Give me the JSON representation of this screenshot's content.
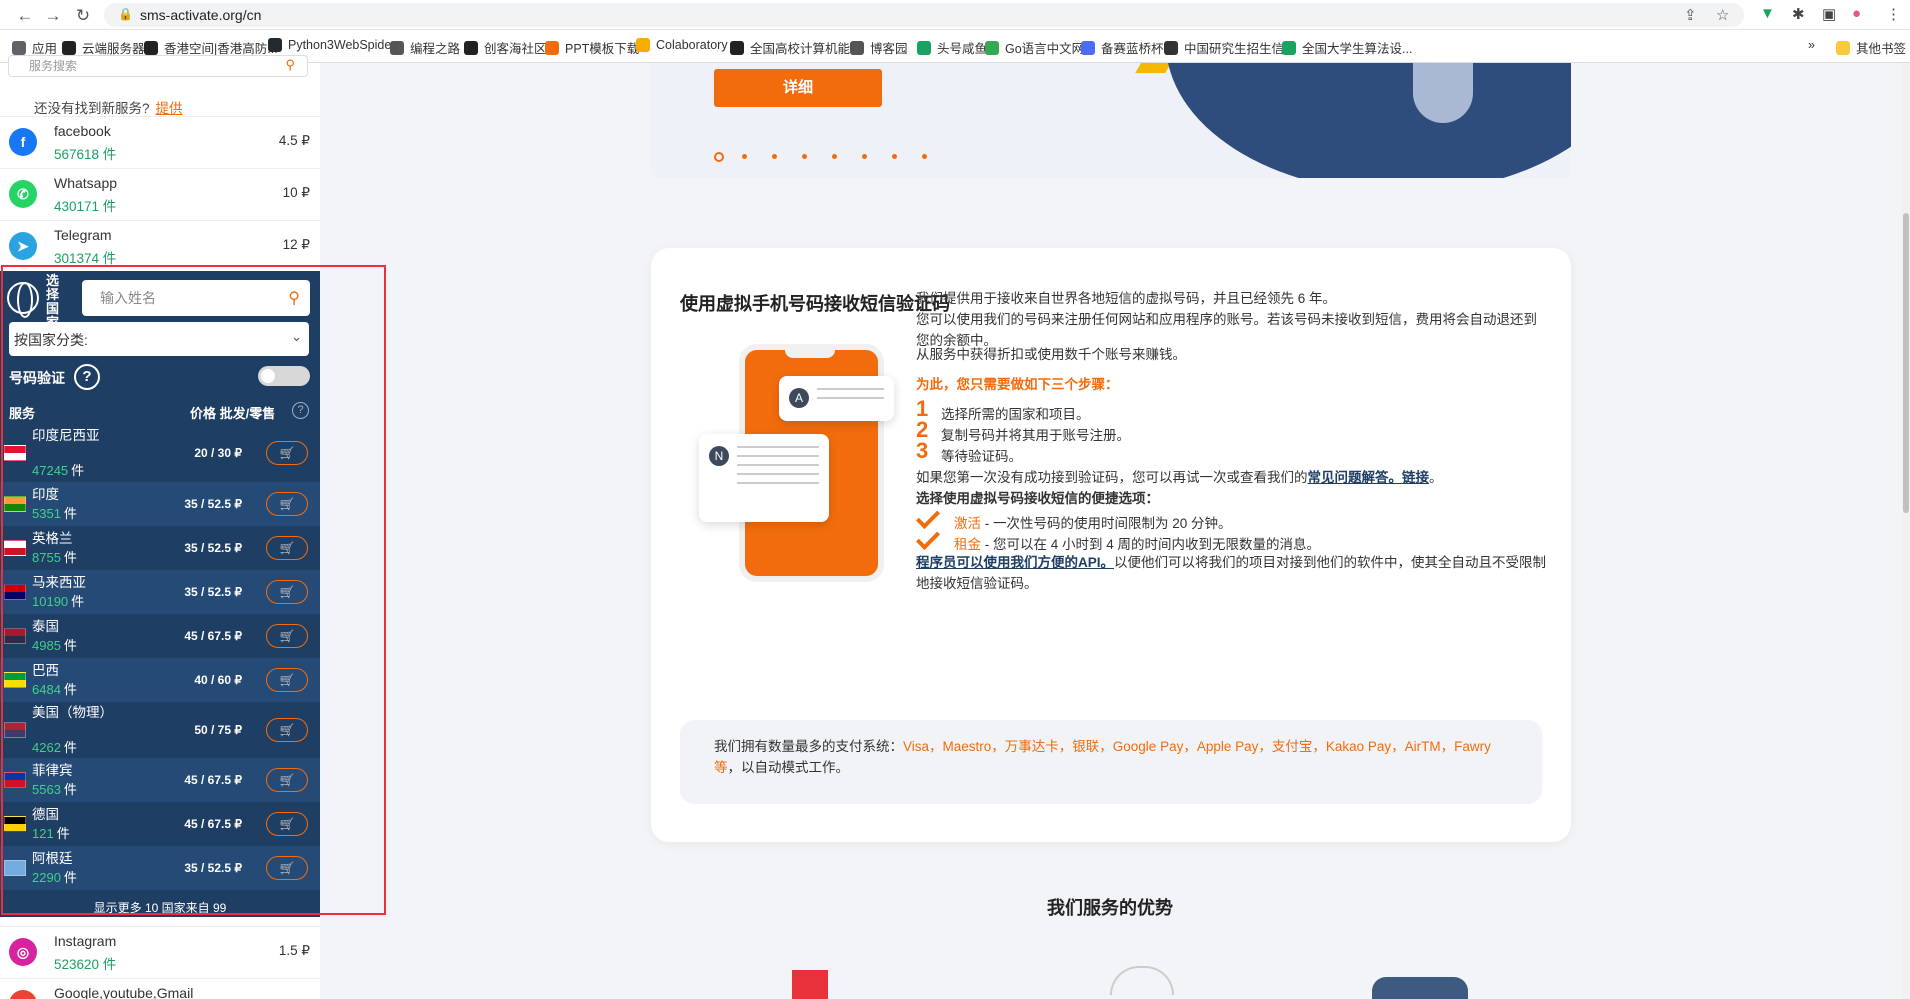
{
  "browser": {
    "url": "sms-activate.org/cn",
    "bookmarks": [
      {
        "label": "应用",
        "color": "#5f6368"
      },
      {
        "label": "云端服务器",
        "color": "#222222"
      },
      {
        "label": "香港空间|香港高防...",
        "color": "#222222"
      },
      {
        "label": "Python3WebSpider",
        "color": "#24292e"
      },
      {
        "label": "编程之路",
        "color": "#555555"
      },
      {
        "label": "创客海社区",
        "color": "#222222"
      },
      {
        "label": "PPT模板下载",
        "color": "#f26c0d"
      },
      {
        "label": "Colaboratory",
        "color": "#f9ab00"
      },
      {
        "label": "全国高校计算机能...",
        "color": "#222222"
      },
      {
        "label": "博客园",
        "color": "#555555"
      },
      {
        "label": "头号咸鱼",
        "color": "#1aa260"
      },
      {
        "label": "Go语言中文网",
        "color": "#34a853"
      },
      {
        "label": "备赛蓝桥杯",
        "color": "#4a6cf7"
      },
      {
        "label": "中国研究生招生信...",
        "color": "#333333"
      },
      {
        "label": "全国大学生算法设...",
        "color": "#1aa260"
      }
    ],
    "other_bookmarks": "其他书签"
  },
  "left": {
    "search_placeholder": "服务搜索",
    "not_found": "还没有找到新服务?",
    "suggest_link": "提供",
    "services_top": [
      {
        "name": "facebook",
        "count": "567618 件",
        "price": "4.5 ₽",
        "color": "#1877f2",
        "letter": "f"
      },
      {
        "name": "Whatsapp",
        "count": "430171 件",
        "price": "10 ₽",
        "color": "#25d366",
        "letter": "✆"
      },
      {
        "name": "Telegram",
        "count": "301374 件",
        "price": "12 ₽",
        "color": "#2aa3df",
        "letter": "➤"
      }
    ],
    "services_bottom": [
      {
        "name": "Instagram",
        "count": "523620 件",
        "price": "1.5 ₽",
        "color": "#d6249f",
        "letter": "◎"
      },
      {
        "name": "Google,youtube,Gmail",
        "count": "",
        "price": "",
        "color": "#ea4335",
        "letter": "G"
      }
    ]
  },
  "panel": {
    "vertical_label": "选择国家",
    "name_placeholder": "输入姓名",
    "category_select": "按国家分类:",
    "verify_label": "号码验证",
    "col_service": "服务",
    "col_price": "价格 批发/零售",
    "countries": [
      {
        "name": "印度尼西亚",
        "count": "47245",
        "unit": "件",
        "price": "20 / 30 ₽",
        "flag_top": "#e8112d",
        "flag_bottom": "#ffffff"
      },
      {
        "name": "印度",
        "count": "5351",
        "unit": "件",
        "price": "35 / 52.5 ₽",
        "flag_top": "#ff9933",
        "flag_bottom": "#138808"
      },
      {
        "name": "英格兰",
        "count": "8755",
        "unit": "件",
        "price": "35 / 52.5 ₽",
        "flag_top": "#ffffff",
        "flag_bottom": "#ce1124"
      },
      {
        "name": "马来西亚",
        "count": "10190",
        "unit": "件",
        "price": "35 / 52.5 ₽",
        "flag_top": "#cc0001",
        "flag_bottom": "#010066"
      },
      {
        "name": "泰国",
        "count": "4985",
        "unit": "件",
        "price": "45 / 67.5 ₽",
        "flag_top": "#a51931",
        "flag_bottom": "#2d2a4a"
      },
      {
        "name": "巴西",
        "count": "6484",
        "unit": "件",
        "price": "40 / 60 ₽",
        "flag_top": "#009c3b",
        "flag_bottom": "#ffdf00"
      },
      {
        "name": "美国（物理）",
        "count": "4262",
        "unit": "件",
        "price": "50 / 75 ₽",
        "flag_top": "#b22234",
        "flag_bottom": "#3c3b6e"
      },
      {
        "name": "菲律宾",
        "count": "5563",
        "unit": "件",
        "price": "45 / 67.5 ₽",
        "flag_top": "#0038a8",
        "flag_bottom": "#ce1126"
      },
      {
        "name": "德国",
        "count": "121",
        "unit": "件",
        "price": "45 / 67.5 ₽",
        "flag_top": "#000000",
        "flag_bottom": "#ffce00"
      },
      {
        "name": "阿根廷",
        "count": "2290",
        "unit": "件",
        "price": "35 / 52.5 ₽",
        "flag_top": "#74acdf",
        "flag_bottom": "#74acdf"
      }
    ],
    "show_more": "显示更多 10 国家来自 99"
  },
  "hero": {
    "detail_button": "详细"
  },
  "card": {
    "title": "使用虚拟手机号码接收短信验证码",
    "p1": "我们提供用于接收来自世界各地短信的虚拟号码，并且已经领先 6 年。",
    "p2": "您可以使用我们的号码来注册任何网站和应用程序的账号。若该号码未接收到短信，费用将会自动退还到您的余额中。",
    "p3": "从服务中获得折扣或使用数千个账号来赚钱。",
    "steps_intro": "为此，您只需要做如下三个步骤：",
    "steps": [
      {
        "num": "1",
        "text": "选择所需的国家和项目。"
      },
      {
        "num": "2",
        "text": "复制号码并将其用于账号注册。"
      },
      {
        "num": "3",
        "text": "等待验证码。"
      }
    ],
    "retry_text": "如果您第一次没有成功接到验证码，您可以再试一次或查看我们的",
    "faq_link": "常见问题解答。链接",
    "retry_end": "。",
    "options_title": "选择使用虚拟号码接收短信的便捷选项：",
    "options": [
      {
        "name": "激活",
        "desc": " - 一次性号码的使用时间限制为 20 分钟。"
      },
      {
        "name": "租金",
        "desc": " - 您可以在 4 小时到 4 周的时间内收到无限数量的消息。"
      }
    ],
    "api_link": "程序员可以使用我们方便的API。",
    "api_text": "以便他们可以将我们的项目对接到他们的软件中，使其全自动且不受限制地接收短信验证码。",
    "pay_intro": "我们拥有数量最多的支付系统：",
    "pay_methods": "Visa，Maestro，万事达卡，银联，Google Pay，Apple Pay，支付宝，Kakao Pay，AirTM，Fawry等",
    "pay_end": "，以自动模式工作。"
  },
  "advantages_title": "我们服务的优势"
}
